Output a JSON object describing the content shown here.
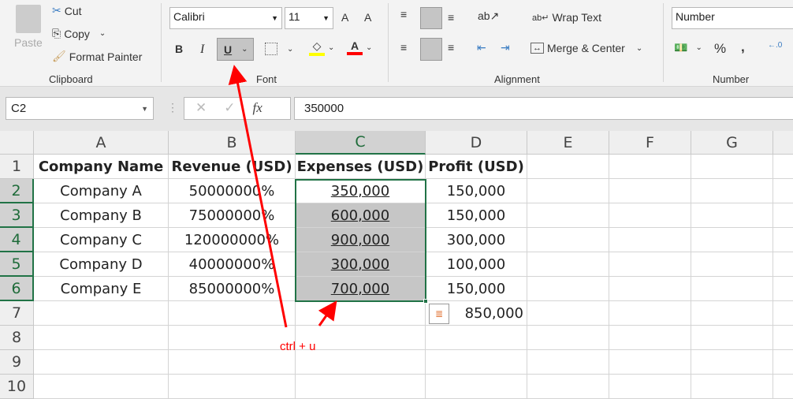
{
  "ribbon": {
    "clipboard": {
      "paste": "Paste",
      "cut": "Cut",
      "copy": "Copy",
      "format_painter": "Format Painter",
      "label": "Clipboard"
    },
    "font": {
      "name": "Calibri",
      "size": "11",
      "bold": "B",
      "italic": "I",
      "underline": "U",
      "label": "Font",
      "underline_active": true,
      "fill_color": "#ffff00",
      "font_color": "#ff0000"
    },
    "alignment": {
      "wrap_text": "Wrap Text",
      "merge_center": "Merge & Center",
      "label": "Alignment"
    },
    "number": {
      "format": "Number",
      "percent": "%",
      "comma": ",",
      "label": "Number"
    }
  },
  "formula_bar": {
    "name_box": "C2",
    "fx": "fx",
    "value": "350000"
  },
  "sheet": {
    "columns": [
      "A",
      "B",
      "C",
      "D",
      "E",
      "F",
      "G"
    ],
    "rows": [
      "1",
      "2",
      "3",
      "4",
      "5",
      "6",
      "7",
      "8",
      "9",
      "10"
    ],
    "header": [
      "Company Name",
      "Revenue (USD)",
      "Expenses (USD)",
      "Profit (USD)"
    ],
    "data": [
      [
        "Company A",
        "50000000%",
        "350,000",
        "150,000"
      ],
      [
        "Company B",
        "75000000%",
        "600,000",
        "150,000"
      ],
      [
        "Company C",
        "120000000%",
        "900,000",
        "300,000"
      ],
      [
        "Company D",
        "40000000%",
        "300,000",
        "100,000"
      ],
      [
        "Company E",
        "85000000%",
        "700,000",
        "150,000"
      ]
    ],
    "d7": "850,000",
    "selection": "C2:C6"
  },
  "annotation": {
    "text": "ctrl + u",
    "color": "#ff0000"
  }
}
